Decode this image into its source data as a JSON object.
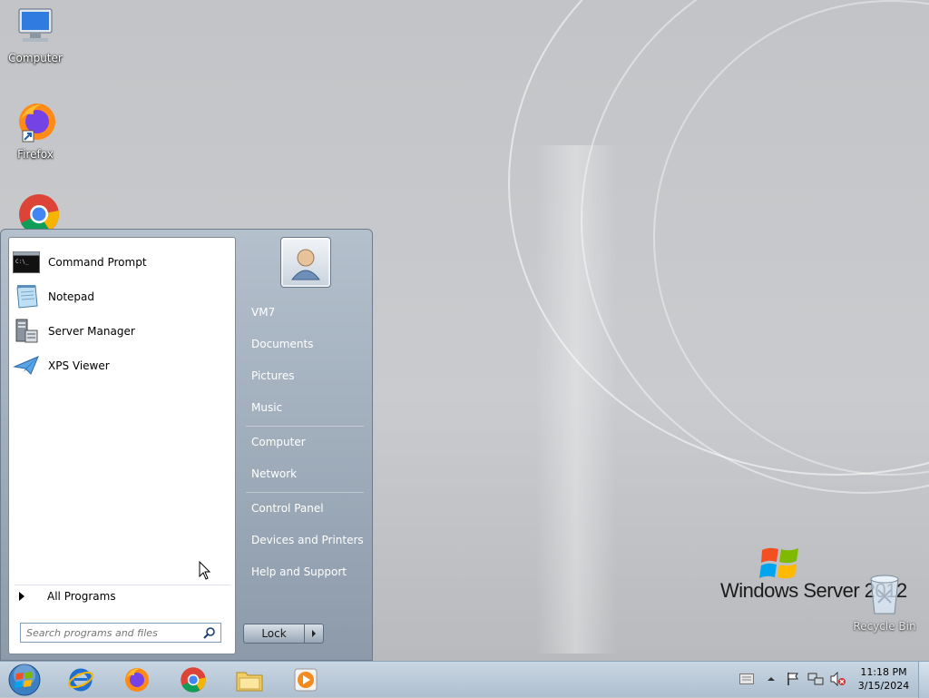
{
  "desktop": {
    "icons": [
      {
        "label": "Computer",
        "icon": "computer-icon"
      },
      {
        "label": "Firefox",
        "icon": "firefox-icon"
      },
      {
        "label": "",
        "icon": "chrome-icon"
      },
      {
        "label": "Recycle Bin",
        "icon": "recycle-bin-icon"
      }
    ],
    "branding": {
      "text": "Windows Server 2012"
    }
  },
  "start_menu": {
    "programs": [
      {
        "label": "Command Prompt",
        "icon": "command-prompt-icon"
      },
      {
        "label": "Notepad",
        "icon": "notepad-icon"
      },
      {
        "label": "Server Manager",
        "icon": "server-manager-icon"
      },
      {
        "label": "XPS Viewer",
        "icon": "xps-viewer-icon"
      }
    ],
    "all_programs_label": "All Programs",
    "search_placeholder": "Search programs and files",
    "right_items": [
      {
        "label": "VM7"
      },
      {
        "label": "Documents"
      },
      {
        "label": "Pictures"
      },
      {
        "label": "Music"
      },
      {
        "label": "Computer"
      },
      {
        "label": "Network"
      },
      {
        "label": "Control Panel"
      },
      {
        "label": "Devices and Printers"
      },
      {
        "label": "Help and Support"
      }
    ],
    "lock_label": "Lock"
  },
  "taskbar": {
    "pinned": [
      {
        "icon": "internet-explorer-icon"
      },
      {
        "icon": "firefox-icon"
      },
      {
        "icon": "chrome-icon"
      },
      {
        "icon": "file-explorer-icon"
      },
      {
        "icon": "media-player-icon"
      }
    ],
    "clock": {
      "time": "11:18 PM",
      "date": "3/15/2024"
    }
  },
  "colors": {
    "accent": "#1e6fd0",
    "taskbar": "#b8c8d8"
  }
}
